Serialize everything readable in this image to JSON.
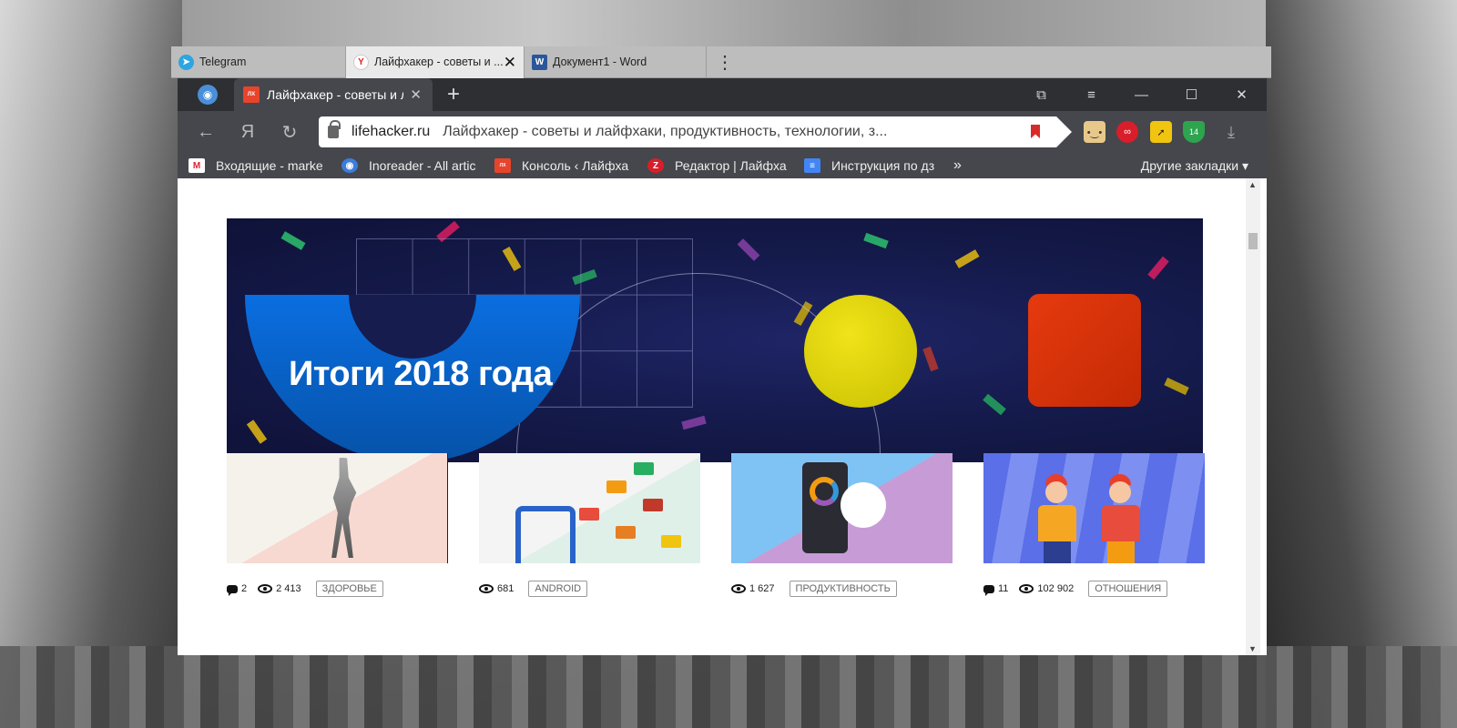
{
  "os_tabs": [
    {
      "label": "Telegram",
      "icon": "telegram-icon"
    },
    {
      "label": "Лайфхакер - советы и ...",
      "icon": "yandex-icon"
    },
    {
      "label": "Документ1 - Word",
      "icon": "word-icon"
    }
  ],
  "browser": {
    "tab_title": "Лайфхакер - советы и л",
    "address": {
      "host": "lifehacker.ru",
      "title": "Лайфхакер - советы и лайфхаки, продуктивность, технологии, з..."
    },
    "bookmarks": [
      {
        "label": "Входящие - marke",
        "icon": "gmail-icon"
      },
      {
        "label": "Inoreader - All artic",
        "icon": "inoreader-icon"
      },
      {
        "label": "Консоль ‹ Лайфха",
        "icon": "lifehacker-icon"
      },
      {
        "label": "Редактор | Лайфха",
        "icon": "editor-icon"
      },
      {
        "label": "Инструкция по дз",
        "icon": "docs-icon"
      }
    ],
    "other_bookmarks": "Другие закладки",
    "extension_badge": "14"
  },
  "page": {
    "hero_title": "Итоги 2018 года",
    "hero_colors": {
      "blue": "#0a6ee0",
      "yellow": "#e6d80f",
      "red": "#d9350b",
      "bg": "#141a4a"
    },
    "cards": [
      {
        "comments": "2",
        "views": "2 413",
        "tag": "ЗДОРОВЬЕ"
      },
      {
        "views": "681",
        "tag": "ANDROID"
      },
      {
        "views": "1 627",
        "tag": "ПРОДУКТИВНОСТЬ"
      },
      {
        "comments": "11",
        "views": "102 902",
        "tag": "ОТНОШЕНИЯ"
      }
    ]
  }
}
